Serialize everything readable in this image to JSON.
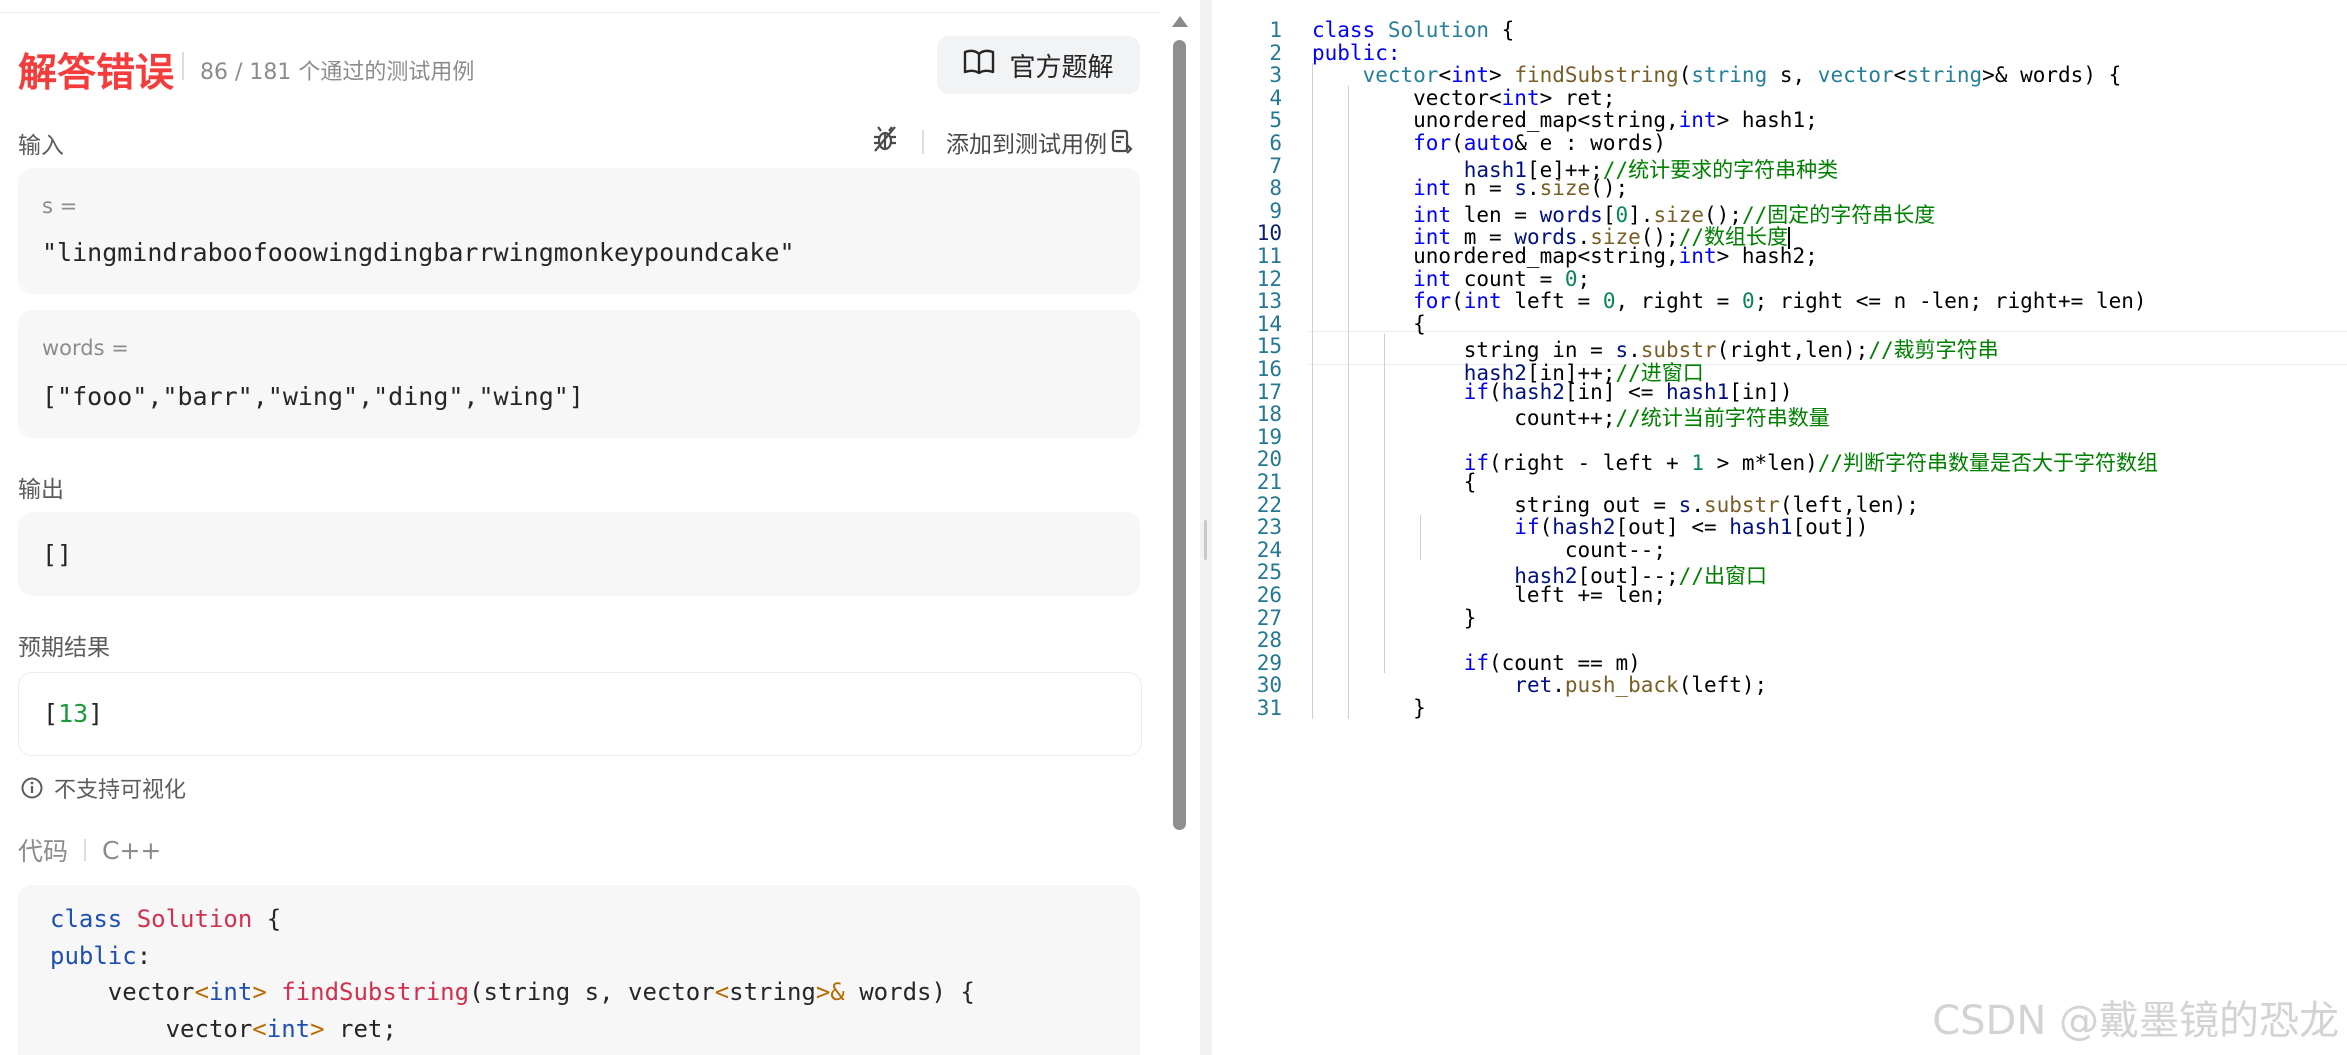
{
  "result": {
    "title": "解答错误",
    "count_text": "86 / 181 个通过的测试用例",
    "solution_button": "官方题解"
  },
  "input": {
    "label": "输入",
    "add_testcase": "添加到测试用例",
    "vars": [
      {
        "name": "s =",
        "value": "\"lingmindraboofooowingdingbarrwingmonkeypoundcake\""
      },
      {
        "name": "words =",
        "value": "[\"fooo\",\"barr\",\"wing\",\"ding\",\"wing\"]"
      }
    ]
  },
  "output": {
    "label": "输出",
    "value": "[]"
  },
  "expected": {
    "label": "预期结果",
    "open": "[",
    "number": "13",
    "close": "]"
  },
  "visualize_note": "不支持可视化",
  "code_section": {
    "label": "代码",
    "language": "C++"
  },
  "left_code": [
    [
      {
        "t": "class ",
        "c": "lk"
      },
      {
        "t": "Solution",
        "c": "lc"
      },
      {
        "t": " {",
        "c": ""
      }
    ],
    [
      {
        "t": "public",
        "c": "lk"
      },
      {
        "t": ":",
        "c": ""
      }
    ],
    [
      {
        "t": "    vector",
        "c": ""
      },
      {
        "t": "<",
        "c": "lp"
      },
      {
        "t": "int",
        "c": "lt"
      },
      {
        "t": "> ",
        "c": "lp"
      },
      {
        "t": "findSubstring",
        "c": "lc"
      },
      {
        "t": "(string s, vector",
        "c": ""
      },
      {
        "t": "<",
        "c": "lp"
      },
      {
        "t": "string",
        "c": ""
      },
      {
        "t": ">&",
        "c": "lp"
      },
      {
        "t": " words) {",
        "c": ""
      }
    ],
    [
      {
        "t": "        vector",
        "c": ""
      },
      {
        "t": "<",
        "c": "lp"
      },
      {
        "t": "int",
        "c": "lt"
      },
      {
        "t": ">",
        "c": "lp"
      },
      {
        "t": " ret;",
        "c": ""
      }
    ]
  ],
  "editor": {
    "lines": [
      [
        {
          "t": "class ",
          "c": "kw"
        },
        {
          "t": "Solution",
          "c": "ty"
        },
        {
          "t": " {",
          "c": ""
        }
      ],
      [
        {
          "t": "public:",
          "c": "kw"
        }
      ],
      [
        {
          "t": "    vector",
          "c": "ty"
        },
        {
          "t": "<",
          "c": ""
        },
        {
          "t": "int",
          "c": "kw"
        },
        {
          "t": "> ",
          "c": ""
        },
        {
          "t": "findSubstring",
          "c": "fn"
        },
        {
          "t": "(",
          "c": ""
        },
        {
          "t": "string",
          "c": "ty"
        },
        {
          "t": " s, ",
          "c": ""
        },
        {
          "t": "vector",
          "c": "ty"
        },
        {
          "t": "<",
          "c": ""
        },
        {
          "t": "string",
          "c": "ty"
        },
        {
          "t": ">& words) {",
          "c": ""
        }
      ],
      [
        {
          "t": "        vector<",
          "c": ""
        },
        {
          "t": "int",
          "c": "kw"
        },
        {
          "t": "> ret;",
          "c": ""
        }
      ],
      [
        {
          "t": "        unordered_map<string,",
          "c": ""
        },
        {
          "t": "int",
          "c": "kw"
        },
        {
          "t": "> hash1;",
          "c": ""
        }
      ],
      [
        {
          "t": "        ",
          "c": ""
        },
        {
          "t": "for",
          "c": "kw"
        },
        {
          "t": "(",
          "c": ""
        },
        {
          "t": "auto",
          "c": "kw"
        },
        {
          "t": "& e : words)",
          "c": ""
        }
      ],
      [
        {
          "t": "            ",
          "c": ""
        },
        {
          "t": "hash1",
          "c": "vr"
        },
        {
          "t": "[e]++;",
          "c": ""
        },
        {
          "t": "//统计要求的字符串种类",
          "c": "cm"
        }
      ],
      [
        {
          "t": "        ",
          "c": ""
        },
        {
          "t": "int",
          "c": "kw"
        },
        {
          "t": " n = ",
          "c": ""
        },
        {
          "t": "s",
          "c": "vr"
        },
        {
          "t": ".",
          "c": ""
        },
        {
          "t": "size",
          "c": "fn"
        },
        {
          "t": "();",
          "c": ""
        }
      ],
      [
        {
          "t": "        ",
          "c": ""
        },
        {
          "t": "int",
          "c": "kw"
        },
        {
          "t": " len = ",
          "c": ""
        },
        {
          "t": "words",
          "c": "vr"
        },
        {
          "t": "[",
          "c": ""
        },
        {
          "t": "0",
          "c": "nm"
        },
        {
          "t": "].",
          "c": ""
        },
        {
          "t": "size",
          "c": "fn"
        },
        {
          "t": "();",
          "c": ""
        },
        {
          "t": "//固定的字符串长度",
          "c": "cm"
        }
      ],
      [
        {
          "t": "        ",
          "c": ""
        },
        {
          "t": "int",
          "c": "kw"
        },
        {
          "t": " m = ",
          "c": ""
        },
        {
          "t": "words",
          "c": "vr"
        },
        {
          "t": ".",
          "c": ""
        },
        {
          "t": "size",
          "c": "fn"
        },
        {
          "t": "();",
          "c": ""
        },
        {
          "t": "//数组长度",
          "c": "cm"
        }
      ],
      [
        {
          "t": "        unordered_map<string,",
          "c": ""
        },
        {
          "t": "int",
          "c": "kw"
        },
        {
          "t": "> hash2;",
          "c": ""
        }
      ],
      [
        {
          "t": "        ",
          "c": ""
        },
        {
          "t": "int",
          "c": "kw"
        },
        {
          "t": " count = ",
          "c": ""
        },
        {
          "t": "0",
          "c": "nm"
        },
        {
          "t": ";",
          "c": ""
        }
      ],
      [
        {
          "t": "        ",
          "c": ""
        },
        {
          "t": "for",
          "c": "kw"
        },
        {
          "t": "(",
          "c": ""
        },
        {
          "t": "int",
          "c": "kw"
        },
        {
          "t": " left = ",
          "c": ""
        },
        {
          "t": "0",
          "c": "nm"
        },
        {
          "t": ", right = ",
          "c": ""
        },
        {
          "t": "0",
          "c": "nm"
        },
        {
          "t": "; right <= n -len; right+= len)",
          "c": ""
        }
      ],
      [
        {
          "t": "        {",
          "c": ""
        }
      ],
      [
        {
          "t": "            string in = ",
          "c": ""
        },
        {
          "t": "s",
          "c": "vr"
        },
        {
          "t": ".",
          "c": ""
        },
        {
          "t": "substr",
          "c": "fn"
        },
        {
          "t": "(right,len);",
          "c": ""
        },
        {
          "t": "//裁剪字符串",
          "c": "cm"
        }
      ],
      [
        {
          "t": "            ",
          "c": ""
        },
        {
          "t": "hash2",
          "c": "vr"
        },
        {
          "t": "[in]++;",
          "c": ""
        },
        {
          "t": "//进窗口",
          "c": "cm"
        }
      ],
      [
        {
          "t": "            ",
          "c": ""
        },
        {
          "t": "if",
          "c": "kw"
        },
        {
          "t": "(",
          "c": ""
        },
        {
          "t": "hash2",
          "c": "vr"
        },
        {
          "t": "[in] <= ",
          "c": ""
        },
        {
          "t": "hash1",
          "c": "vr"
        },
        {
          "t": "[in])",
          "c": ""
        }
      ],
      [
        {
          "t": "                count++;",
          "c": ""
        },
        {
          "t": "//统计当前字符串数量",
          "c": "cm"
        }
      ],
      [
        {
          "t": "",
          "c": ""
        }
      ],
      [
        {
          "t": "            ",
          "c": ""
        },
        {
          "t": "if",
          "c": "kw"
        },
        {
          "t": "(right - left + ",
          "c": ""
        },
        {
          "t": "1",
          "c": "nm"
        },
        {
          "t": " > m*len)",
          "c": ""
        },
        {
          "t": "//判断字符串数量是否大于字符数组",
          "c": "cm"
        }
      ],
      [
        {
          "t": "            {",
          "c": ""
        }
      ],
      [
        {
          "t": "                string out = ",
          "c": ""
        },
        {
          "t": "s",
          "c": "vr"
        },
        {
          "t": ".",
          "c": ""
        },
        {
          "t": "substr",
          "c": "fn"
        },
        {
          "t": "(left,len);",
          "c": ""
        }
      ],
      [
        {
          "t": "                ",
          "c": ""
        },
        {
          "t": "if",
          "c": "kw"
        },
        {
          "t": "(",
          "c": ""
        },
        {
          "t": "hash2",
          "c": "vr"
        },
        {
          "t": "[out] <= ",
          "c": ""
        },
        {
          "t": "hash1",
          "c": "vr"
        },
        {
          "t": "[out])",
          "c": ""
        }
      ],
      [
        {
          "t": "                    count--;",
          "c": ""
        }
      ],
      [
        {
          "t": "                ",
          "c": ""
        },
        {
          "t": "hash2",
          "c": "vr"
        },
        {
          "t": "[out]--;",
          "c": ""
        },
        {
          "t": "//出窗口",
          "c": "cm"
        }
      ],
      [
        {
          "t": "                left += len;",
          "c": ""
        }
      ],
      [
        {
          "t": "            }",
          "c": ""
        }
      ],
      [
        {
          "t": "",
          "c": ""
        }
      ],
      [
        {
          "t": "            ",
          "c": ""
        },
        {
          "t": "if",
          "c": "kw"
        },
        {
          "t": "(count == m)",
          "c": ""
        }
      ],
      [
        {
          "t": "                ",
          "c": ""
        },
        {
          "t": "ret",
          "c": "vr"
        },
        {
          "t": ".",
          "c": ""
        },
        {
          "t": "push_back",
          "c": "fn"
        },
        {
          "t": "(left);",
          "c": ""
        }
      ],
      [
        {
          "t": "        }",
          "c": ""
        }
      ]
    ],
    "active_line": 10
  },
  "watermark": "CSDN @戴墨镜的恐龙"
}
